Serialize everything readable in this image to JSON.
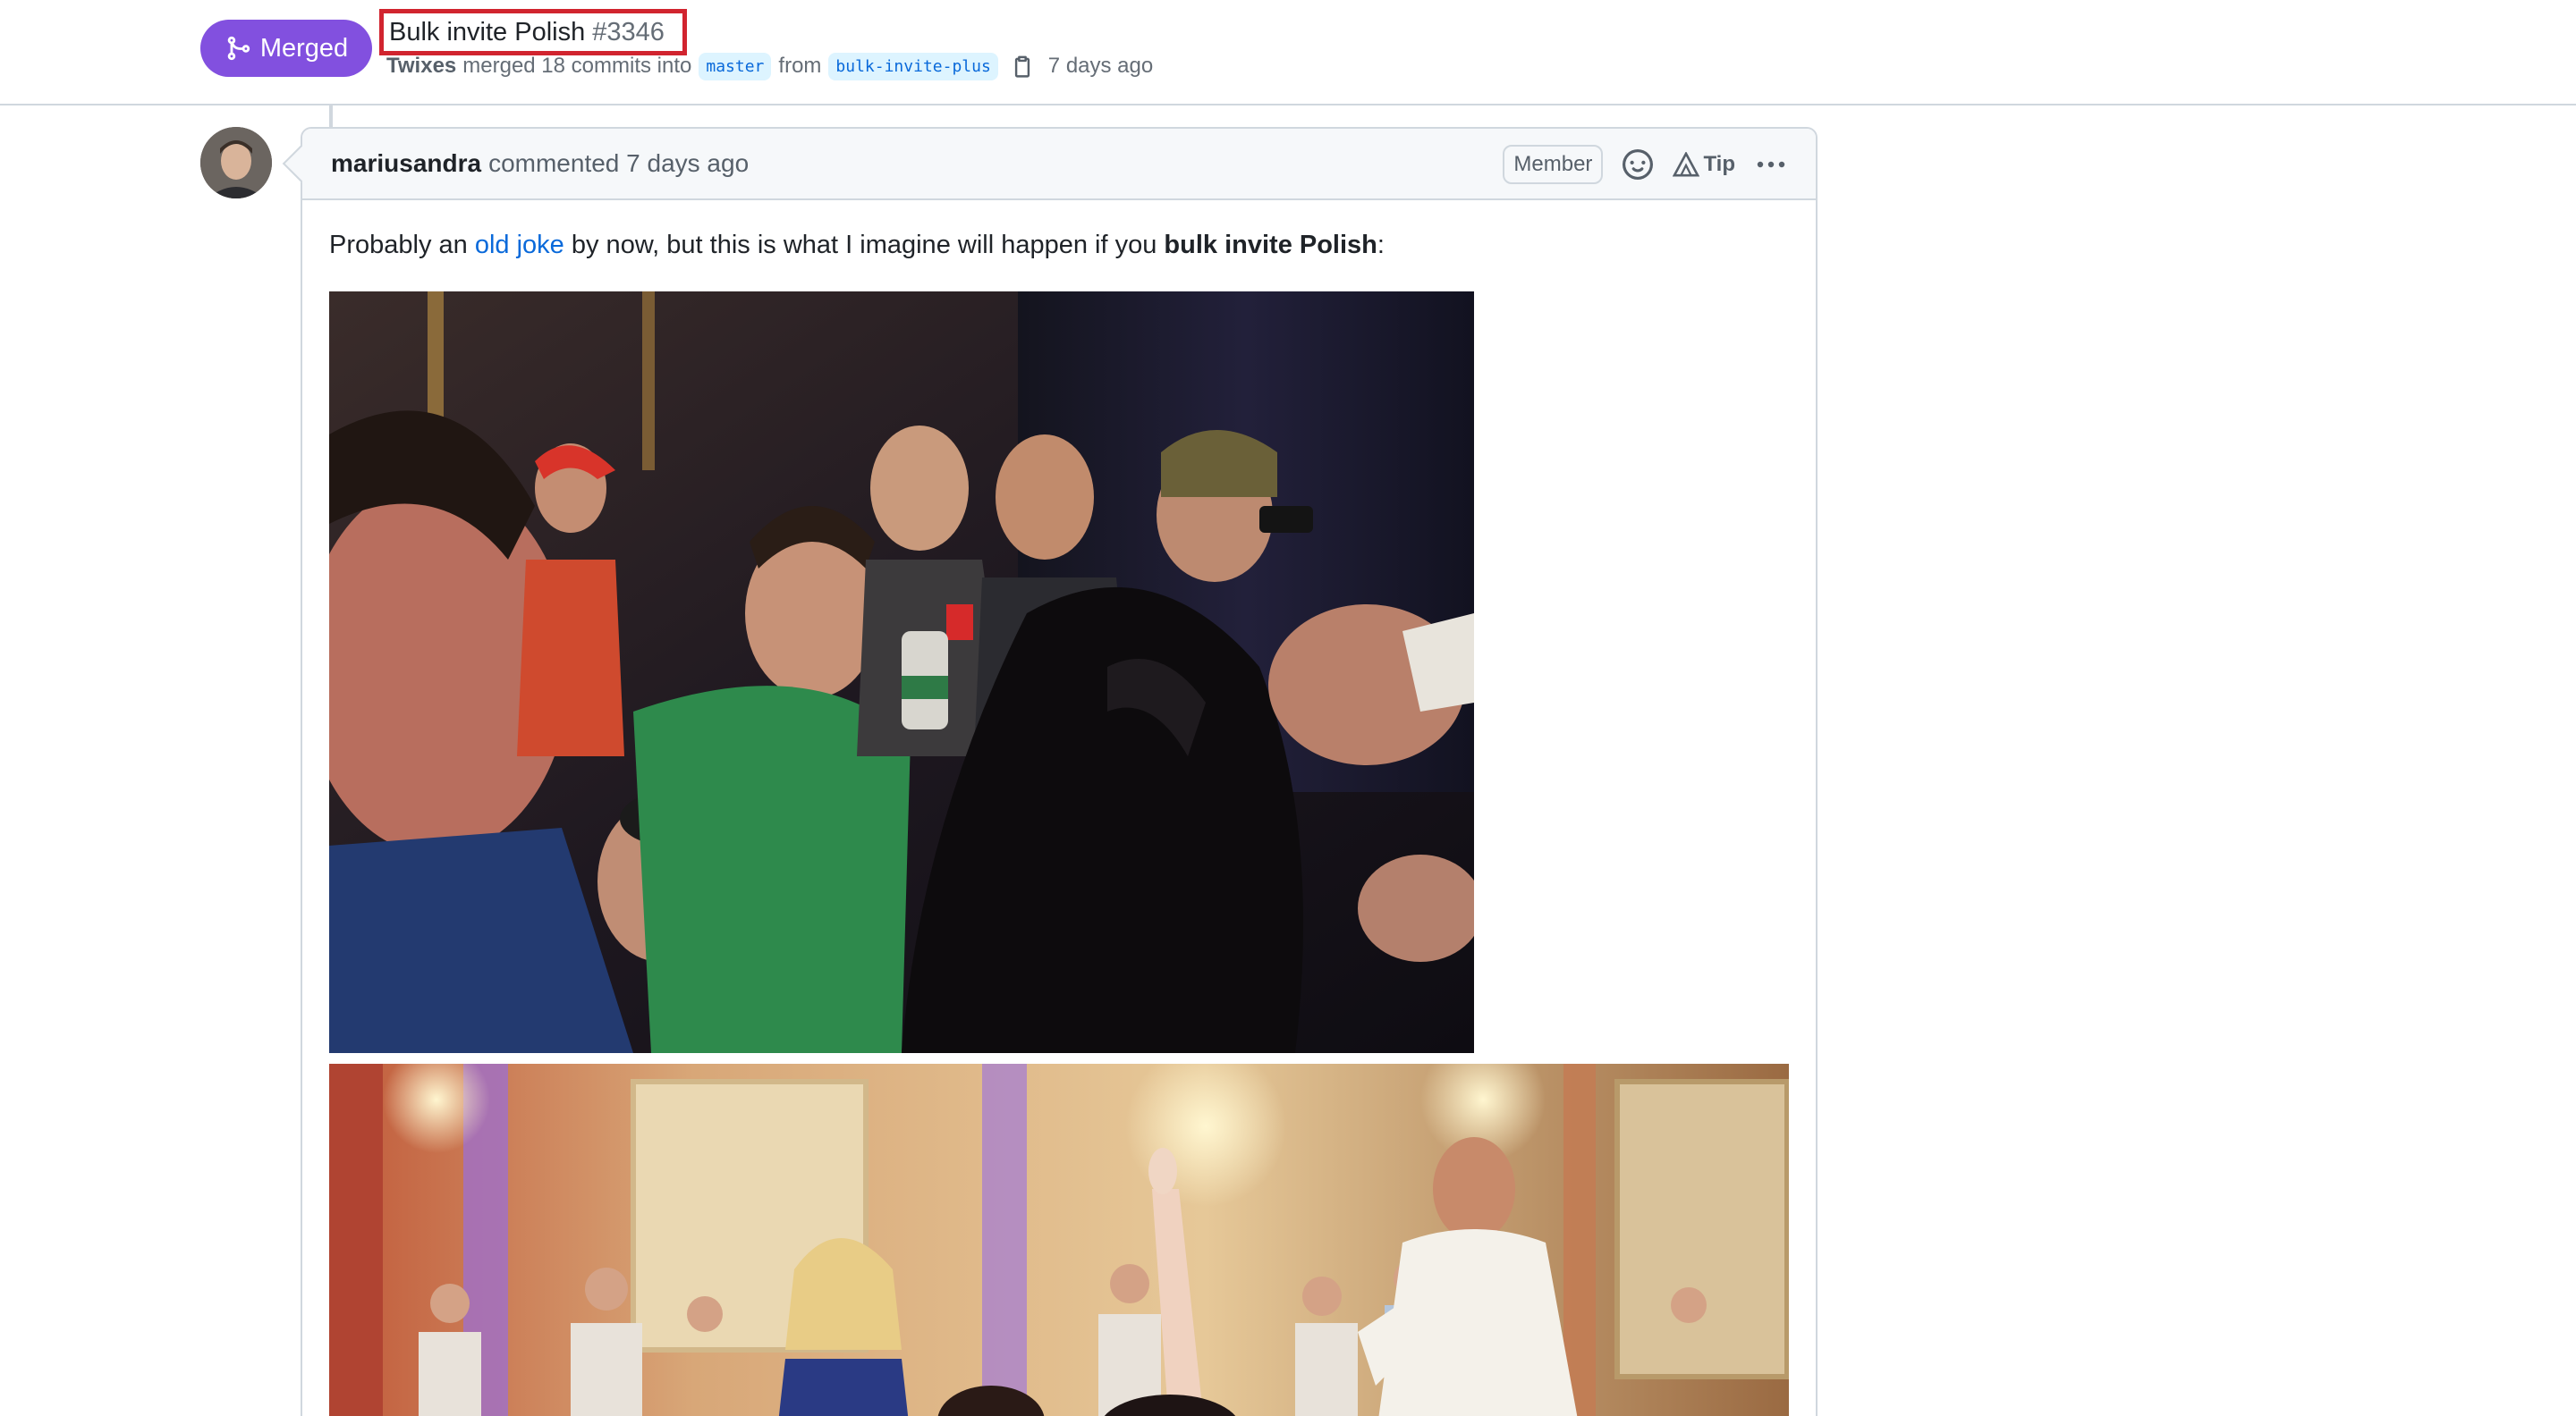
{
  "pr": {
    "state": "Merged",
    "title": "Bulk invite Polish",
    "number": "#3346",
    "author": "Twixes",
    "merge_text": "merged 18 commits into",
    "base_branch": "master",
    "from_text": "from",
    "head_branch": "bulk-invite-plus",
    "time": "7 days ago"
  },
  "comment": {
    "author": "mariusandra",
    "action": "commented 7 days ago",
    "badge": "Member",
    "tip_label": "Tip",
    "body": {
      "part1": "Probably an",
      "link": "old joke",
      "part2": "by now, but this is what I imagine will happen if you",
      "bold": "bulk invite Polish",
      "part3": ":"
    }
  },
  "colors": {
    "merged_purple": "#8250df",
    "link_blue": "#0969da",
    "highlight_red": "#d1242f"
  },
  "icons": [
    "git-merge-icon",
    "copy-icon",
    "smiley-icon",
    "alert-triangle-icon",
    "kebab-horizontal-icon"
  ]
}
